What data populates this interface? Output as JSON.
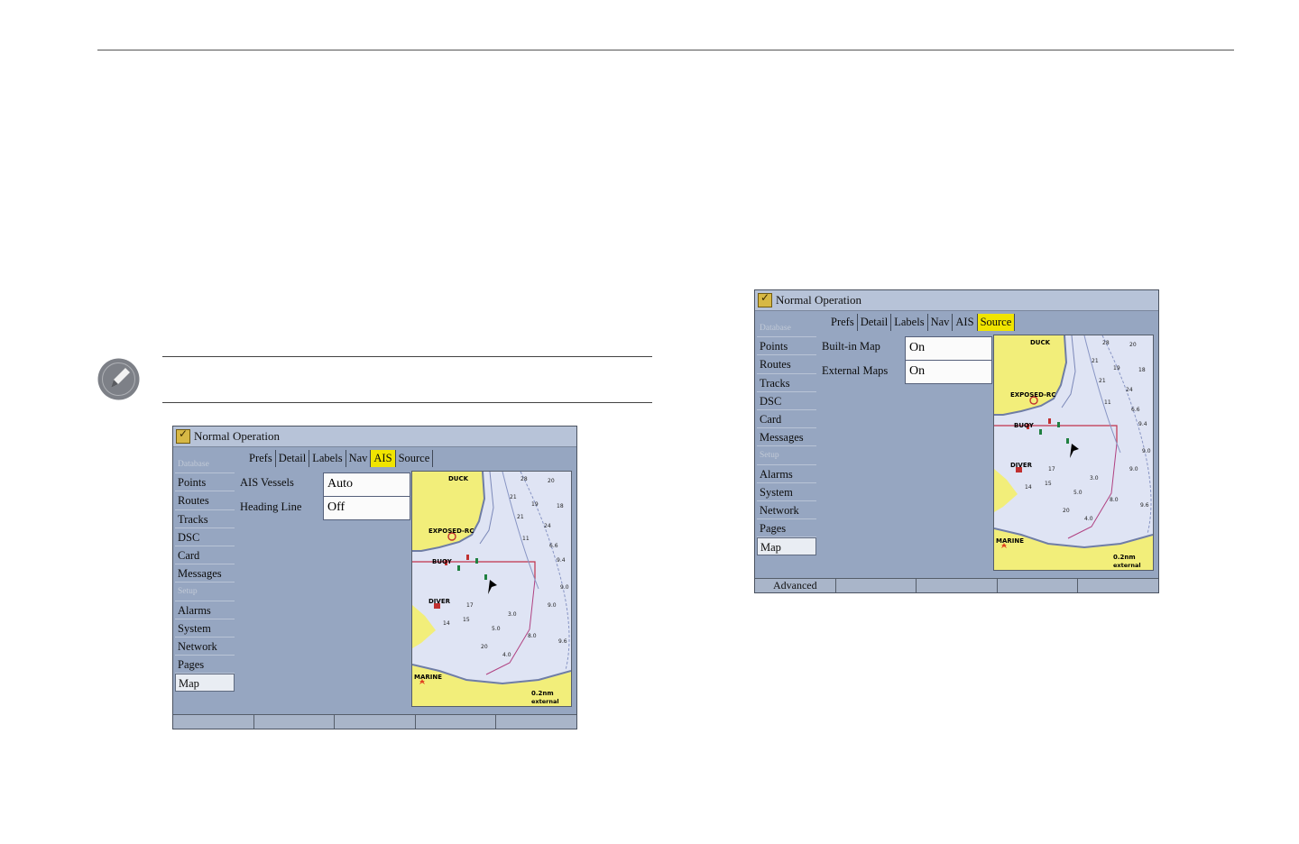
{
  "screens": [
    {
      "title": "Normal Operation",
      "sidebar": [
        "Database",
        "Points",
        "Routes",
        "Tracks",
        "DSC",
        "Card",
        "Messages",
        "Setup",
        "Alarms",
        "System",
        "Network",
        "Pages",
        "Map"
      ],
      "tabs": [
        "Prefs",
        "Detail",
        "Labels",
        "Nav",
        "AIS",
        "Source"
      ],
      "active_tab": "AIS",
      "fields": [
        {
          "label": "AIS Vessels",
          "value": "Auto"
        },
        {
          "label": "Heading Line",
          "value": "Off"
        }
      ],
      "softkeys": [
        "",
        "",
        "",
        "",
        ""
      ]
    },
    {
      "title": "Normal Operation",
      "sidebar": [
        "Database",
        "Points",
        "Routes",
        "Tracks",
        "DSC",
        "Card",
        "Messages",
        "Setup",
        "Alarms",
        "System",
        "Network",
        "Pages",
        "Map"
      ],
      "tabs": [
        "Prefs",
        "Detail",
        "Labels",
        "Nav",
        "AIS",
        "Source"
      ],
      "active_tab": "Source",
      "fields": [
        {
          "label": "Built-in Map",
          "value": "On"
        },
        {
          "label": "External Maps",
          "value": "On"
        }
      ],
      "softkeys": [
        "Advanced",
        "",
        "",
        "",
        ""
      ]
    }
  ],
  "map_labels": {
    "duck": "DUCK",
    "exposed": "EXPOSED-RC",
    "buoy": "BUOY",
    "diver": "DIVER",
    "marine": "MARINE",
    "scale": "0.2nm",
    "mode": "external"
  },
  "depths": [
    "28",
    "20",
    "21",
    "19",
    "18",
    "21",
    "24",
    "11",
    "6.6",
    "9.4",
    "9.0",
    "9.0",
    "3.0",
    "5.0",
    "8.0",
    "9.6",
    "4.0",
    "17",
    "15",
    "14",
    "20"
  ],
  "colors": {
    "screen_bg": "#96a6c1",
    "active_tab": "#f0e400",
    "land": "#f2ee7a",
    "water": "#dfe4f4"
  },
  "icons": {
    "note": "pencil-note-icon",
    "title": "checkmark-icon",
    "vessel": "boat-arrow-icon"
  }
}
